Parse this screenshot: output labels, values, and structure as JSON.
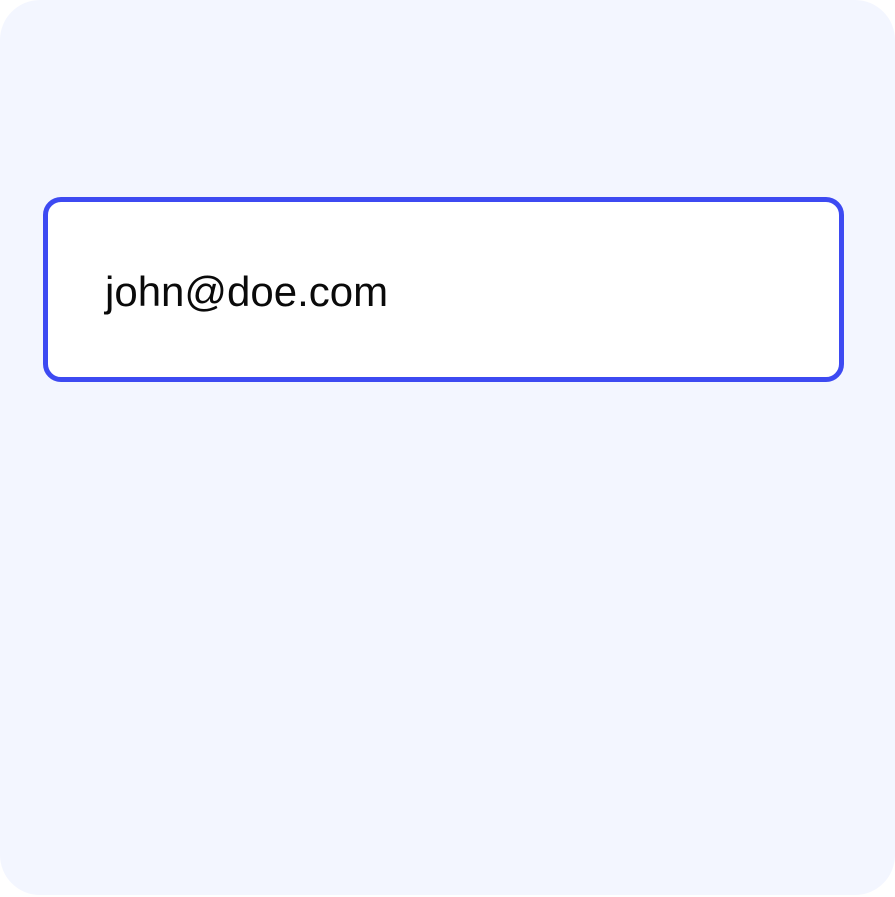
{
  "email_field": {
    "value": "john@doe.com",
    "state": "focused"
  },
  "colors": {
    "background": "#f3f6ff",
    "field_background": "#ffffff",
    "focus_border": "#3d4af2",
    "text": "#0a0a0a"
  }
}
